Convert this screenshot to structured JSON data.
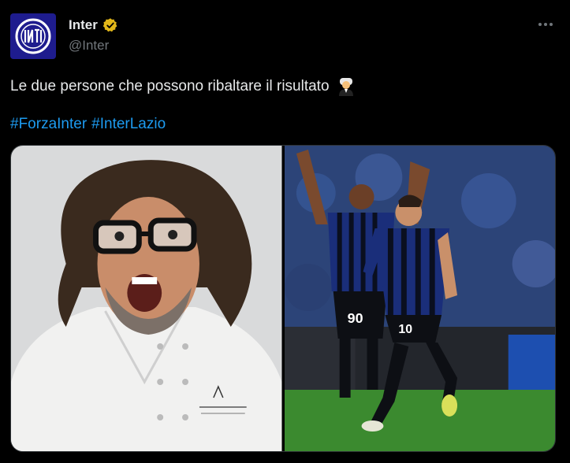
{
  "account": {
    "display_name": "Inter",
    "handle": "@Inter",
    "verified_badge": "gold-verified-icon",
    "avatar_icon": "inter-crest-icon",
    "logo_colors": {
      "background": "#1e1c8e",
      "mark": "#ffffff"
    }
  },
  "post": {
    "text": "Le due persone che possono ribaltare il risultato",
    "emoji": "man-judge-emoji",
    "hashtags": [
      "#ForzaInter",
      "#InterLazio"
    ],
    "more_icon": "more-options-icon"
  },
  "media": [
    {
      "name": "photo-chef"
    },
    {
      "name": "photo-players"
    }
  ],
  "colors": {
    "link": "#1d9bf0",
    "text": "#e7e9ea",
    "muted": "#71767b",
    "background": "#000000",
    "verified": "#e2b719"
  }
}
